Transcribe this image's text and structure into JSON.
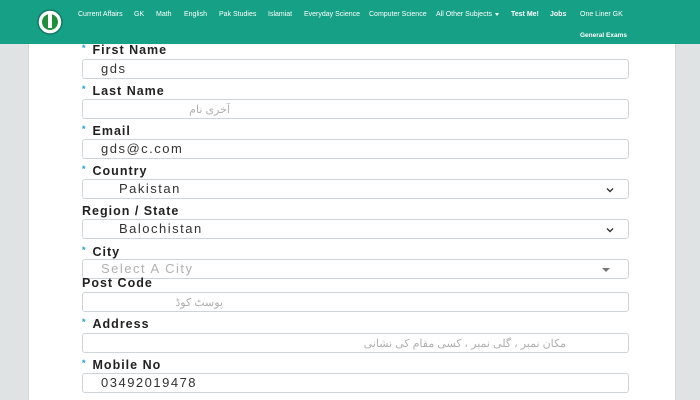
{
  "nav": {
    "logo_icon": "site-logo-icon",
    "items": [
      "Current Affairs",
      "GK",
      "Math",
      "English",
      "Pak Studies",
      "Islamiat",
      "Everyday Science",
      "Computer Science",
      "All Other Subjects",
      "Test Me!",
      "Jobs",
      "One Liner GK"
    ],
    "second_row": [
      "General Exams"
    ]
  },
  "form": {
    "first_name": {
      "label": "First Name",
      "value": "gds"
    },
    "last_name": {
      "label": "Last Name",
      "placeholder": "آخری نام"
    },
    "email": {
      "label": "Email",
      "value": "gds@c.com"
    },
    "country": {
      "label": "Country",
      "value": "Pakistan"
    },
    "region": {
      "label": "Region / State",
      "value": "Balochistan"
    },
    "city": {
      "label": "City",
      "placeholder": "Select A City"
    },
    "post_code": {
      "label": "Post Code",
      "placeholder": "پوسٹ کوڈ"
    },
    "address": {
      "label": "Address",
      "placeholder": "مکان نمبر ، گلی نمبر ، کسی مقام کی نشانی"
    },
    "mobile": {
      "label": "Mobile No",
      "value": "03492019478"
    }
  },
  "colors": {
    "navbar": "#16a085",
    "accent": "#1a9fd9"
  }
}
